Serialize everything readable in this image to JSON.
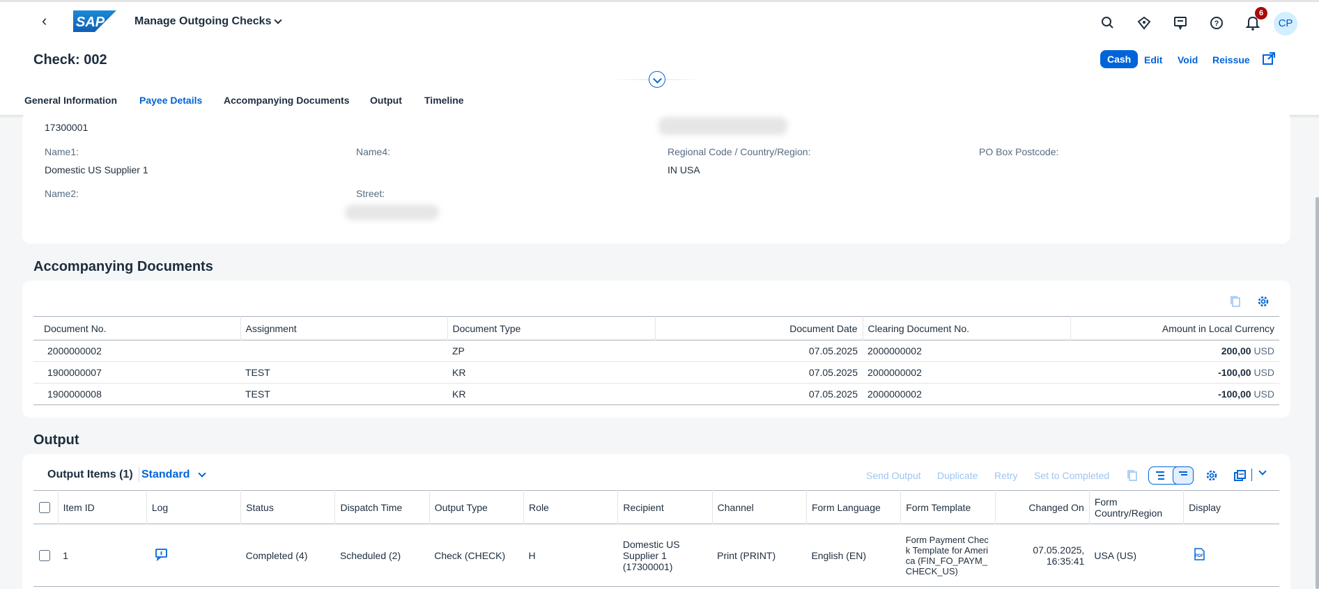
{
  "shell": {
    "logo_text": "SAP",
    "app_title": "Manage Outgoing Checks",
    "notification_count": "6",
    "avatar_initials": "CP"
  },
  "header": {
    "title": "Check: 002",
    "actions": {
      "cash": "Cash",
      "edit": "Edit",
      "void": "Void",
      "reissue": "Reissue"
    },
    "tabs": [
      "General Information",
      "Payee Details",
      "Accompanying Documents",
      "Output",
      "Timeline"
    ],
    "active_tab": "Payee Details"
  },
  "payee": {
    "id_value": "17300001",
    "name1_label": "Name1:",
    "name1_value": "Domestic US Supplier 1",
    "name4_label": "Name4:",
    "region_label": "Regional Code / Country/Region:",
    "region_value": "IN USA",
    "po_box_label": "PO Box Postcode:",
    "name2_label": "Name2:",
    "street_label": "Street:"
  },
  "accompanying": {
    "title": "Accompanying Documents",
    "columns": [
      "Document No.",
      "Assignment",
      "Document Type",
      "Document Date",
      "Clearing Document No.",
      "Amount in Local Currency"
    ],
    "rows": [
      {
        "doc_no": "2000000002",
        "assignment": "",
        "doc_type": "ZP",
        "doc_date": "07.05.2025",
        "clearing": "2000000002",
        "amount": "200,00",
        "currency": "USD"
      },
      {
        "doc_no": "1900000007",
        "assignment": "TEST",
        "doc_type": "KR",
        "doc_date": "07.05.2025",
        "clearing": "2000000002",
        "amount": "-100,00",
        "currency": "USD"
      },
      {
        "doc_no": "1900000008",
        "assignment": "TEST",
        "doc_type": "KR",
        "doc_date": "07.05.2025",
        "clearing": "2000000002",
        "amount": "-100,00",
        "currency": "USD"
      }
    ]
  },
  "output": {
    "title": "Output",
    "items_label": "Output Items (1)",
    "variant": "Standard",
    "toolbar": {
      "send": "Send Output",
      "duplicate": "Duplicate",
      "retry": "Retry",
      "set_completed": "Set to Completed"
    },
    "columns": [
      "Item ID",
      "Log",
      "Status",
      "Dispatch Time",
      "Output Type",
      "Role",
      "Recipient",
      "Channel",
      "Form Language",
      "Form Template",
      "Changed On",
      "Form Country/Region",
      "Display"
    ],
    "rows": [
      {
        "item_id": "1",
        "status": "Completed (4)",
        "dispatch": "Scheduled (2)",
        "output_type": "Check (CHECK)",
        "role": "H",
        "recipient": "Domestic US Supplier 1 (17300001)",
        "channel": "Print (PRINT)",
        "language": "English (EN)",
        "template": "Form Payment Check Template for America (FIN_FO_PAYM_CHECK_US)",
        "changed_on": "07.05.2025, 16:35:41",
        "country": "USA (US)"
      }
    ]
  },
  "colors": {
    "brand": "#0064d9",
    "badge": "#aa0808"
  },
  "icons": [
    "back-icon",
    "search-icon",
    "diamond-icon",
    "feedback-icon",
    "help-icon",
    "bell-icon",
    "chevron-down-icon",
    "share-icon",
    "copy-icon",
    "gear-icon",
    "log-icon",
    "pdf-icon",
    "export-icon"
  ]
}
